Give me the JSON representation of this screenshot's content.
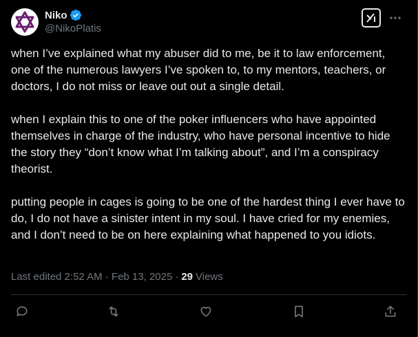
{
  "author": {
    "display_name": "Niko",
    "handle": "@NikoPlatis",
    "verified": true,
    "avatar_icon": "star-of-david-icon"
  },
  "post": {
    "paragraphs": [
      "when I’ve explained what my abuser did to me, be it to law enforcement, one of the numerous lawyers I’ve spoken to, to my mentors, teachers, or doctors, I do not miss or leave out out a single detail.",
      "when I explain this to one of the poker influencers who have appointed themselves in charge of the industry, who have personal incentive to hide the story they “don’t know what I’m talking about”, and I’m a conspiracy theorist.",
      "putting people in cages is going to be one of the hardest thing I ever have to do, I do not have a sinister intent in my soul. I have cried for my enemies, and I don’t need to be on here explaining what happened to you idiots."
    ],
    "edited_label": "Last edited 2:52 AM · Feb 13, 2025",
    "separator": "·",
    "views_count": "29",
    "views_label": "Views"
  },
  "actions": [
    {
      "name": "reply",
      "icon": "reply-icon"
    },
    {
      "name": "repost",
      "icon": "repost-icon"
    },
    {
      "name": "like",
      "icon": "like-icon"
    },
    {
      "name": "bookmark",
      "icon": "bookmark-icon"
    },
    {
      "name": "share",
      "icon": "share-icon"
    }
  ],
  "colors": {
    "background": "#000000",
    "text": "#e7e9ea",
    "muted": "#71767b",
    "verified": "#1d9bf0",
    "avatar_star": "#6b1f6e"
  }
}
